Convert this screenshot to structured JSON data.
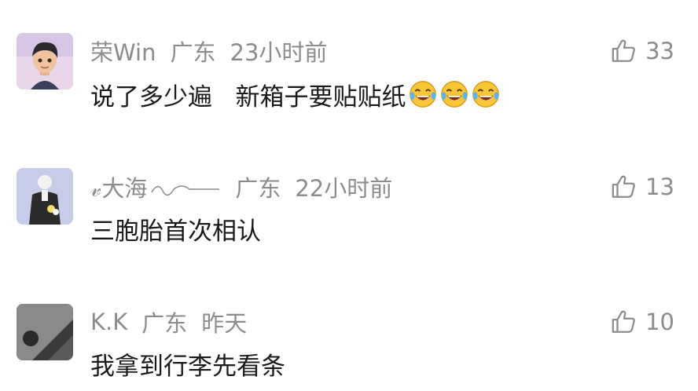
{
  "comments": [
    {
      "username": "荣Win",
      "location": "广东",
      "time": "23小时前",
      "text": "说了多少遍   新箱子要贴贴纸",
      "emojis": [
        "laugh-cry-emoji",
        "laugh-cry-emoji",
        "laugh-cry-emoji"
      ],
      "likes": "33"
    },
    {
      "username": "𝓋大海",
      "location": "广东",
      "time": "22小时前",
      "text": "三胞胎首次相认",
      "likes": "13"
    },
    {
      "username": "K.K",
      "location": "广东",
      "time": "昨天",
      "text": "我拿到行李先看条",
      "likes": "10"
    }
  ],
  "icons": {
    "like": "thumbs-up-icon",
    "emoji": "laugh-cry-emoji"
  },
  "colors": {
    "meta": "#8c8c8c",
    "text": "#1a1a1a",
    "background": "#ffffff"
  }
}
